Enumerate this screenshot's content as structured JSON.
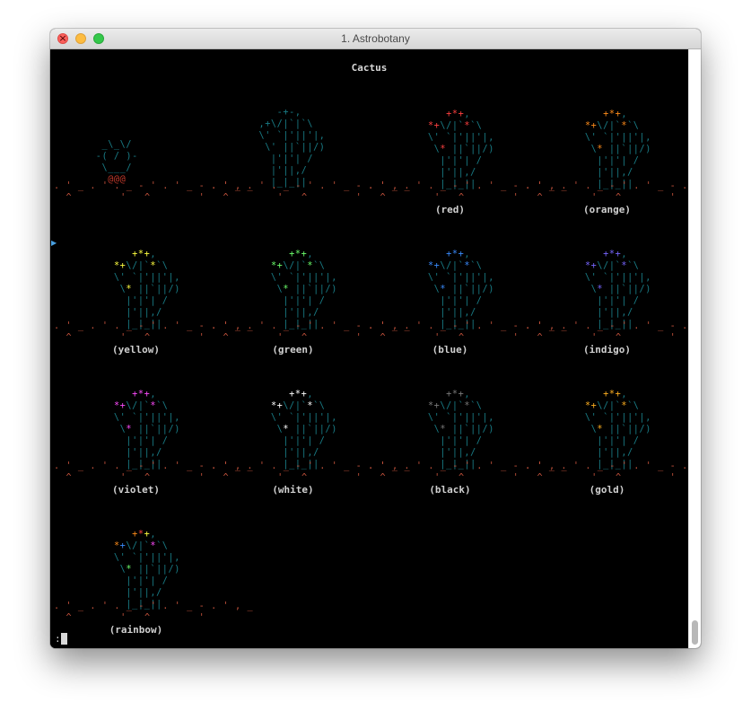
{
  "window": {
    "title": "1. Astrobotany"
  },
  "header": {
    "title": "Cactus"
  },
  "colors": {
    "stem": "#197c86",
    "ground": "#c2513b",
    "pot": "#c0392b",
    "red": "#ff4040",
    "orange": "#ff8c1a",
    "yellow": "#ffff40",
    "green": "#6cff6c",
    "blue": "#3a8cff",
    "indigo": "#7766ff",
    "violet": "#ff4cff",
    "white": "#ffffff",
    "black": "#7a7a7a",
    "gold": "#ffb020"
  },
  "stages": [
    {
      "label": ""
    },
    {
      "label": ""
    },
    {
      "label": "(red)",
      "color": "#ff4040"
    },
    {
      "label": "(orange)",
      "color": "#ff8c1a"
    },
    {
      "label": "(yellow)",
      "color": "#ffff40"
    },
    {
      "label": "(green)",
      "color": "#6cff6c"
    },
    {
      "label": "(blue)",
      "color": "#3a8cff"
    },
    {
      "label": "(indigo)",
      "color": "#7766ff"
    },
    {
      "label": "(violet)",
      "color": "#ff4cff"
    },
    {
      "label": "(white)",
      "color": "#ffffff"
    },
    {
      "label": "(black)",
      "color": "#7a7a7a"
    },
    {
      "label": "(gold)",
      "color": "#ffb020"
    },
    {
      "label": "(rainbow)",
      "rainbow": [
        "#ff8c1a",
        "#3a8cff",
        "#ff4040",
        "#ffff40",
        "#ff4cff",
        "#6cff6c"
      ]
    }
  ],
  "art": {
    "seedling": [
      "  _\\_\\/",
      " -( / )-",
      "  \\___/"
    ],
    "pot_text": "@@@",
    "young": [
      "     -+-,",
      "  ,+\\/|`|`\\",
      "  \\' `|'||'|,",
      "   \\' ||`||/)",
      "    |'|'| /",
      "    |'||,/",
      "    |_|_||"
    ],
    "flower_top": "+*+,",
    "flower_mid": "\\/|`*`\\",
    "flower_left": "*+",
    "cactus_body": [
      "\\' `|'||'|,",
      " \\' ||`||/)",
      "  |'|'| /",
      "  |'||,/",
      "  |_|_||"
    ],
    "ground": ". ' _ . ' . _ - ' . ' _ - . ' , _",
    "ground_marks": "  ^        '   ^        '"
  },
  "terminal": {
    "prompt": ":"
  }
}
